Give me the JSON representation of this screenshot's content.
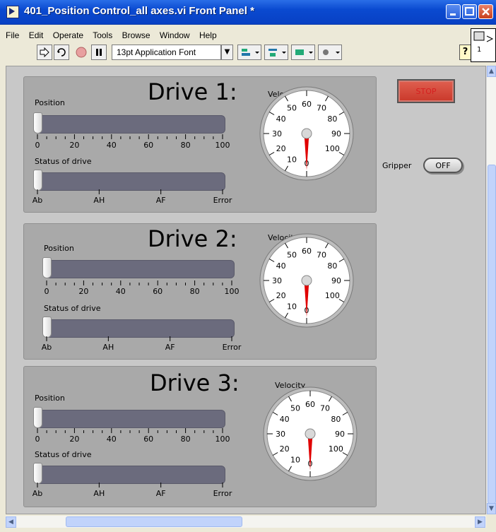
{
  "window": {
    "title": "401_Position Control_all axes.vi Front Panel *"
  },
  "menu": [
    "File",
    "Edit",
    "Operate",
    "Tools",
    "Browse",
    "Window",
    "Help"
  ],
  "toolbar": {
    "font_select": "13pt Application Font",
    "help": "?"
  },
  "controls": {
    "stop_label": "STOP",
    "gripper_label": "Gripper",
    "gripper_state": "OFF"
  },
  "drives": [
    {
      "title": "Drive 1:",
      "position_label": "Position",
      "status_label": "Status of drive",
      "velocity_label": "Velocity",
      "position_value": 0,
      "status_value": 0,
      "velocity_value": 0
    },
    {
      "title": "Drive 2:",
      "position_label": "Position",
      "status_label": "Status of drive",
      "velocity_label": "Velocity",
      "position_value": 0,
      "status_value": 0,
      "velocity_value": 0
    },
    {
      "title": "Drive 3:",
      "position_label": "Position",
      "status_label": "Status of drive",
      "velocity_label": "Velocity",
      "position_value": 0,
      "status_value": 0,
      "velocity_value": 0
    }
  ],
  "position_scale": [
    "0",
    "20",
    "40",
    "60",
    "80",
    "100"
  ],
  "status_scale": [
    "Ab",
    "AH",
    "AF",
    "Error"
  ],
  "velocity_scale": [
    "0",
    "10",
    "20",
    "30",
    "40",
    "50",
    "60",
    "70",
    "80",
    "90",
    "100"
  ],
  "colors": {
    "stop_red": "#d61f1f",
    "needle_red": "#e00000",
    "panel_bg": "#c8c8c8",
    "drive_bg": "#a9a9a9",
    "track": "#6b6b7d"
  }
}
